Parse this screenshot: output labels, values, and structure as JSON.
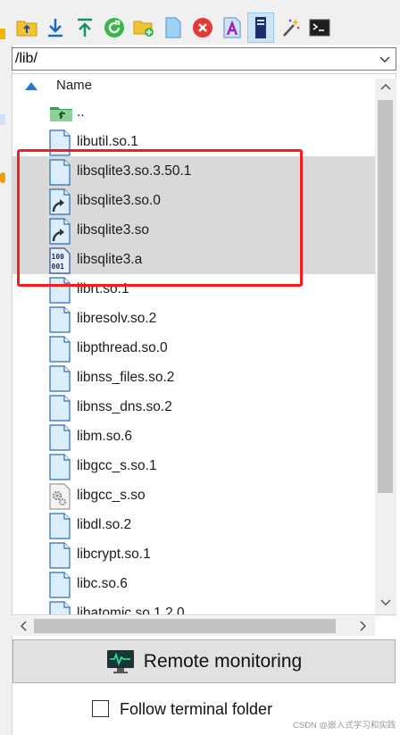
{
  "path": {
    "value": "/lib/"
  },
  "header": {
    "name_label": "Name"
  },
  "files": [
    {
      "name": "..",
      "type": "parent",
      "selected": false
    },
    {
      "name": "libutil.so.1",
      "type": "file",
      "selected": false
    },
    {
      "name": "libsqlite3.so.3.50.1",
      "type": "file",
      "selected": true
    },
    {
      "name": "libsqlite3.so.0",
      "type": "link",
      "selected": true
    },
    {
      "name": "libsqlite3.so",
      "type": "link",
      "selected": true
    },
    {
      "name": "libsqlite3.a",
      "type": "binary",
      "selected": true
    },
    {
      "name": "librt.so.1",
      "type": "file",
      "selected": false
    },
    {
      "name": "libresolv.so.2",
      "type": "file",
      "selected": false
    },
    {
      "name": "libpthread.so.0",
      "type": "file",
      "selected": false
    },
    {
      "name": "libnss_files.so.2",
      "type": "file",
      "selected": false
    },
    {
      "name": "libnss_dns.so.2",
      "type": "file",
      "selected": false
    },
    {
      "name": "libm.so.6",
      "type": "file",
      "selected": false
    },
    {
      "name": "libgcc_s.so.1",
      "type": "file",
      "selected": false
    },
    {
      "name": "libgcc_s.so",
      "type": "gear",
      "selected": false
    },
    {
      "name": "libdl.so.2",
      "type": "file",
      "selected": false
    },
    {
      "name": "libcrypt.so.1",
      "type": "file",
      "selected": false
    },
    {
      "name": "libc.so.6",
      "type": "file",
      "selected": false
    },
    {
      "name": "libatomic.so.1.2.0",
      "type": "file",
      "selected": false
    }
  ],
  "toolbar": [
    {
      "icon": "folder-up-icon"
    },
    {
      "icon": "download-icon"
    },
    {
      "icon": "upload-icon"
    },
    {
      "icon": "refresh-icon"
    },
    {
      "icon": "new-folder-icon"
    },
    {
      "icon": "new-file-icon"
    },
    {
      "icon": "delete-icon"
    },
    {
      "icon": "rename-icon"
    },
    {
      "icon": "toggle-panel-icon",
      "active": true
    },
    {
      "icon": "magic-wand-icon"
    },
    {
      "icon": "terminal-icon"
    }
  ],
  "remote_button": {
    "label": "Remote monitoring",
    "icon": "monitor-icon"
  },
  "follow": {
    "label": "Follow terminal folder",
    "checked": false
  },
  "watermark": "CSDN @嵌入式学习和实践",
  "colors": {
    "selection": "#d9d9d9",
    "highlight": "#ff1a1a",
    "file_icon_fill": "#dbeefc",
    "file_icon_stroke": "#2a6cb3"
  }
}
